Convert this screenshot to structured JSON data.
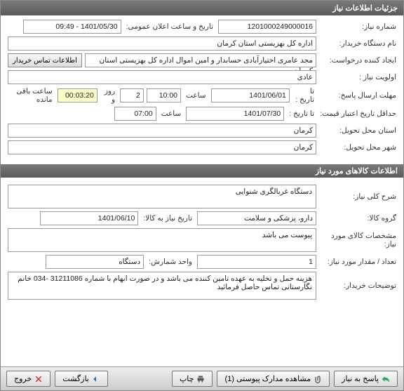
{
  "title_bar": "جزئیات اطلاعات نیاز",
  "fields": {
    "need_number_label": "شماره نیاز:",
    "need_number": "1201000249000016",
    "announce_date_label": "تاریخ و ساعت اعلان عمومی:",
    "announce_date": "1401/05/30 - 09:49",
    "buyer_name_label": "نام دستگاه خریدار:",
    "buyer_name": "اداره کل بهزیستی استان کرمان",
    "requester_label": "ایجاد کننده درخواست:",
    "requester": "مجد عامری اختیارآبادی حسابدار و امین اموال اداره کل بهزیستی استان کرمان",
    "contact_btn": "اطلاعات تماس خریدار",
    "priority_label": "اولویت نیاز :",
    "priority": "عادی",
    "deadline_label": "مهلت ارسال پاسخ:",
    "to_date_label": "تا تاریخ :",
    "deadline_date": "1401/06/01",
    "hour_label": "ساعت",
    "deadline_time": "10:00",
    "days": "2",
    "days_and": "روز و",
    "remain_time": "00:03:20",
    "remain_label": "ساعت باقی مانده",
    "validity_label": "حداقل تاریخ اعتبار قیمت:",
    "validity_date": "1401/07/30",
    "validity_time": "07:00",
    "province_label": "استان محل تحویل:",
    "province": "کرمان",
    "city_label": "شهر محل تحویل:",
    "city": "کرمان"
  },
  "section2_title": "اطلاعات کالاهای مورد نیاز",
  "goods": {
    "desc_label": "شرح کلی نیاز:",
    "desc": "دستگاه غربالگری شنوایی",
    "group_label": "گروه کالا:",
    "group": "دارو، پزشکی و سلامت",
    "need_date_label": "تاریخ نیاز به کالا:",
    "need_date": "1401/06/10",
    "specs_label": "مشخصات کالای مورد نیاز:",
    "specs": "پیوست می باشد",
    "qty_label": "تعداد / مقدار مورد نیاز:",
    "qty": "1",
    "unit_label": "واحد شمارش:",
    "unit": "دستگاه",
    "notes_label": "توضیحات خریدار:",
    "notes": "هزینه حمل و تخلیه به عهده تامین کننده می باشد و در صورت ابهام با شماره 31211086 -034 خانم نگارستانی تماس حاصل فرمائید"
  },
  "buttons": {
    "respond": "پاسخ به نیاز",
    "attachments": "مشاهده مدارک پیوستی (1)",
    "print": "چاپ",
    "back": "بازگشت",
    "exit": "خروج"
  }
}
